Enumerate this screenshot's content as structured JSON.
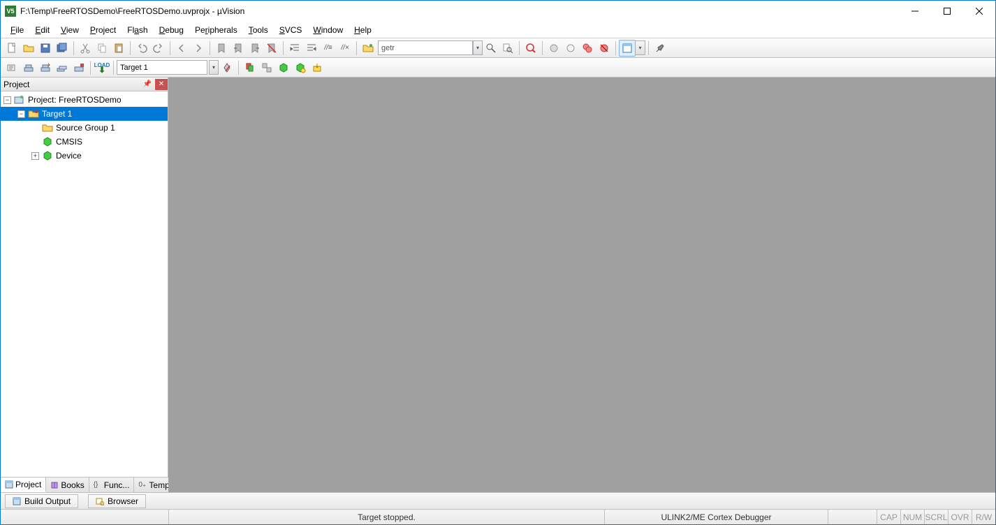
{
  "title": "F:\\Temp\\FreeRTOSDemo\\FreeRTOSDemo.uvprojx - µVision",
  "app_icon_text": "V5",
  "menu": [
    "File",
    "Edit",
    "View",
    "Project",
    "Flash",
    "Debug",
    "Peripherals",
    "Tools",
    "SVCS",
    "Window",
    "Help"
  ],
  "find_text": "getr",
  "target_dropdown": "Target 1",
  "panel_title": "Project",
  "tree": {
    "root": "Project: FreeRTOSDemo",
    "target": "Target 1",
    "children": [
      "Source Group 1",
      "CMSIS",
      "Device"
    ]
  },
  "panel_tabs": [
    "Project",
    "Books",
    "Func...",
    "Temp..."
  ],
  "panel_tab_prefixes": [
    "",
    "",
    "{} ",
    "0₊"
  ],
  "bottom_tabs": [
    "Build Output",
    "Browser"
  ],
  "status": {
    "center1": "Target stopped.",
    "center2": "ULINK2/ME Cortex Debugger",
    "indicators": [
      "CAP",
      "NUM",
      "SCRL",
      "OVR",
      "R/W"
    ]
  }
}
